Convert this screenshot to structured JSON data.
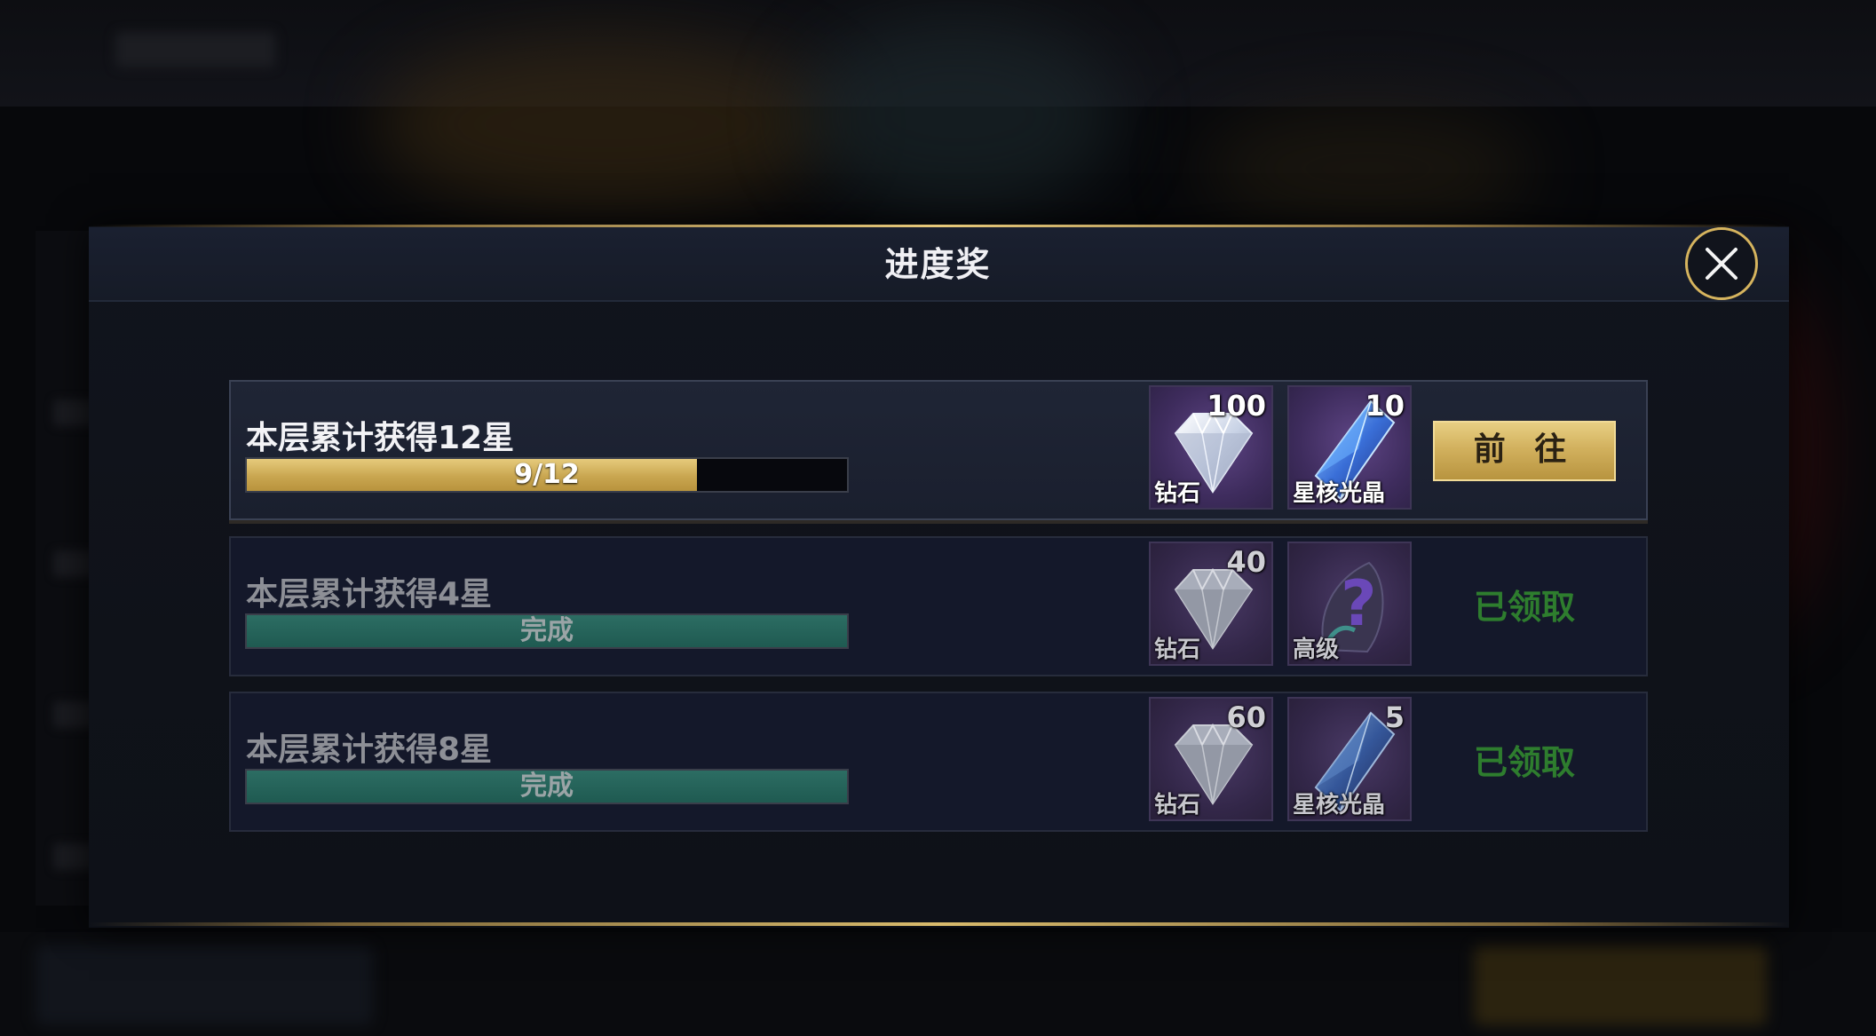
{
  "dialog": {
    "title": "进度奖"
  },
  "rows": [
    {
      "label": "本层累计获得12星",
      "progress_text": "9/12",
      "progress_value": 9,
      "progress_max": 12,
      "state": "active",
      "rewards": [
        {
          "icon": "diamond-icon",
          "name": "钻石",
          "count": "100"
        },
        {
          "icon": "star-core-crystal-icon",
          "name": "星核光晶",
          "count": "10"
        }
      ],
      "action_label": "前 往"
    },
    {
      "label": "本层累计获得4星",
      "progress_text": "完成",
      "progress_value": 4,
      "progress_max": 4,
      "state": "claimed",
      "rewards": [
        {
          "icon": "diamond-icon",
          "name": "钻石",
          "count": "40"
        },
        {
          "icon": "mystery-item-icon",
          "name": "高级",
          "count": ""
        }
      ],
      "action_label": "已领取"
    },
    {
      "label": "本层累计获得8星",
      "progress_text": "完成",
      "progress_value": 8,
      "progress_max": 8,
      "state": "claimed",
      "rewards": [
        {
          "icon": "diamond-icon",
          "name": "钻石",
          "count": "60"
        },
        {
          "icon": "star-core-crystal-icon",
          "name": "星核光晶",
          "count": "5"
        }
      ],
      "action_label": "已领取"
    }
  ],
  "colors": {
    "gold_accent": "#d6b45e",
    "progress_gold": "#c9a650",
    "progress_complete": "#1f5a51",
    "claimed_text": "#2e7d2e",
    "reward_tile": "#3e2c5d"
  }
}
